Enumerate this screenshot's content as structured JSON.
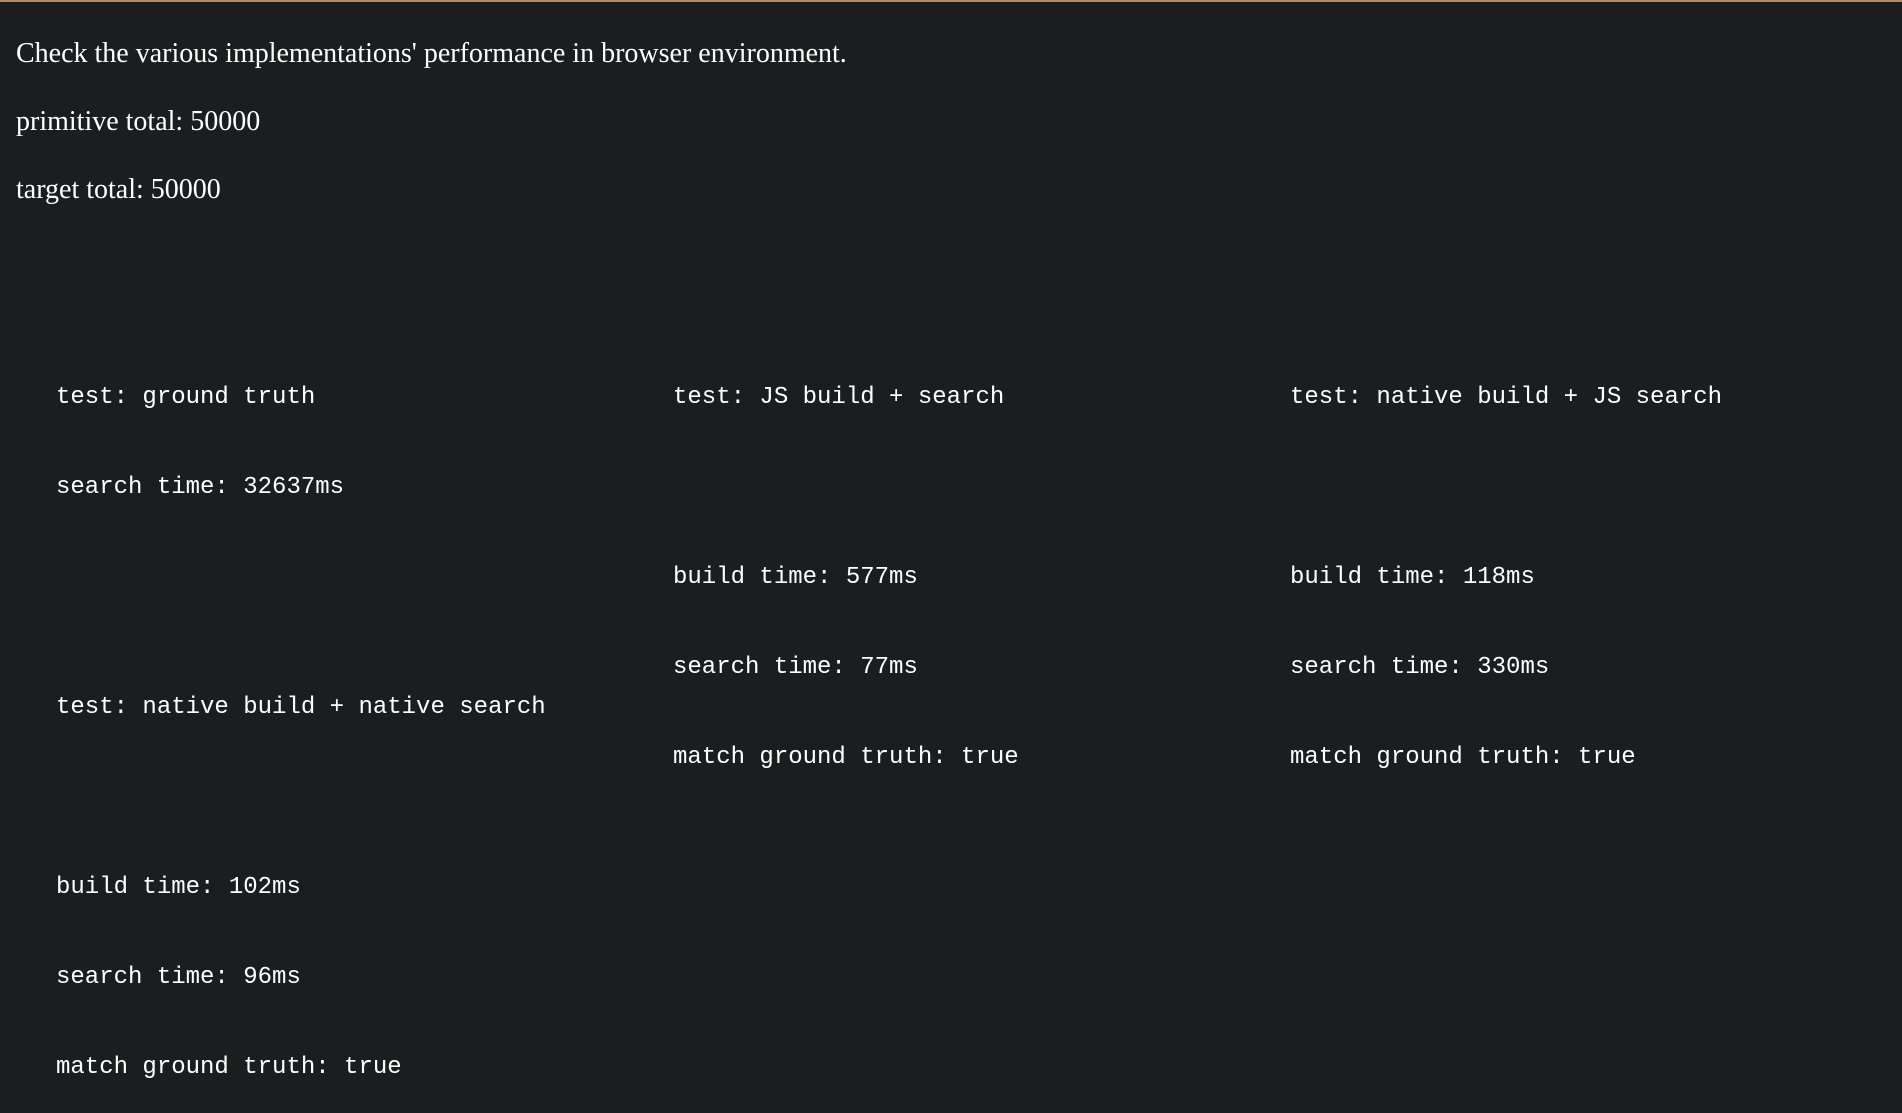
{
  "intro": {
    "description": "Check the various implementations' performance in browser environment.",
    "primitive_total": "primitive total: 50000",
    "target_total": "target total: 50000"
  },
  "results": [
    {
      "test": "test: ground truth",
      "search_time": "search time: 32637ms"
    },
    {
      "test": "test: JS build + search",
      "build_time": "build time: 577ms",
      "search_time": "search time: 77ms",
      "match": "match ground truth: true"
    },
    {
      "test": "test: native build + JS search",
      "build_time": "build time: 118ms",
      "search_time": "search time: 330ms",
      "match": "match ground truth: true"
    },
    {
      "test": "test: native build + native search",
      "build_time": "build time: 102ms",
      "search_time": "search time: 96ms",
      "match": "match ground truth: true"
    }
  ]
}
